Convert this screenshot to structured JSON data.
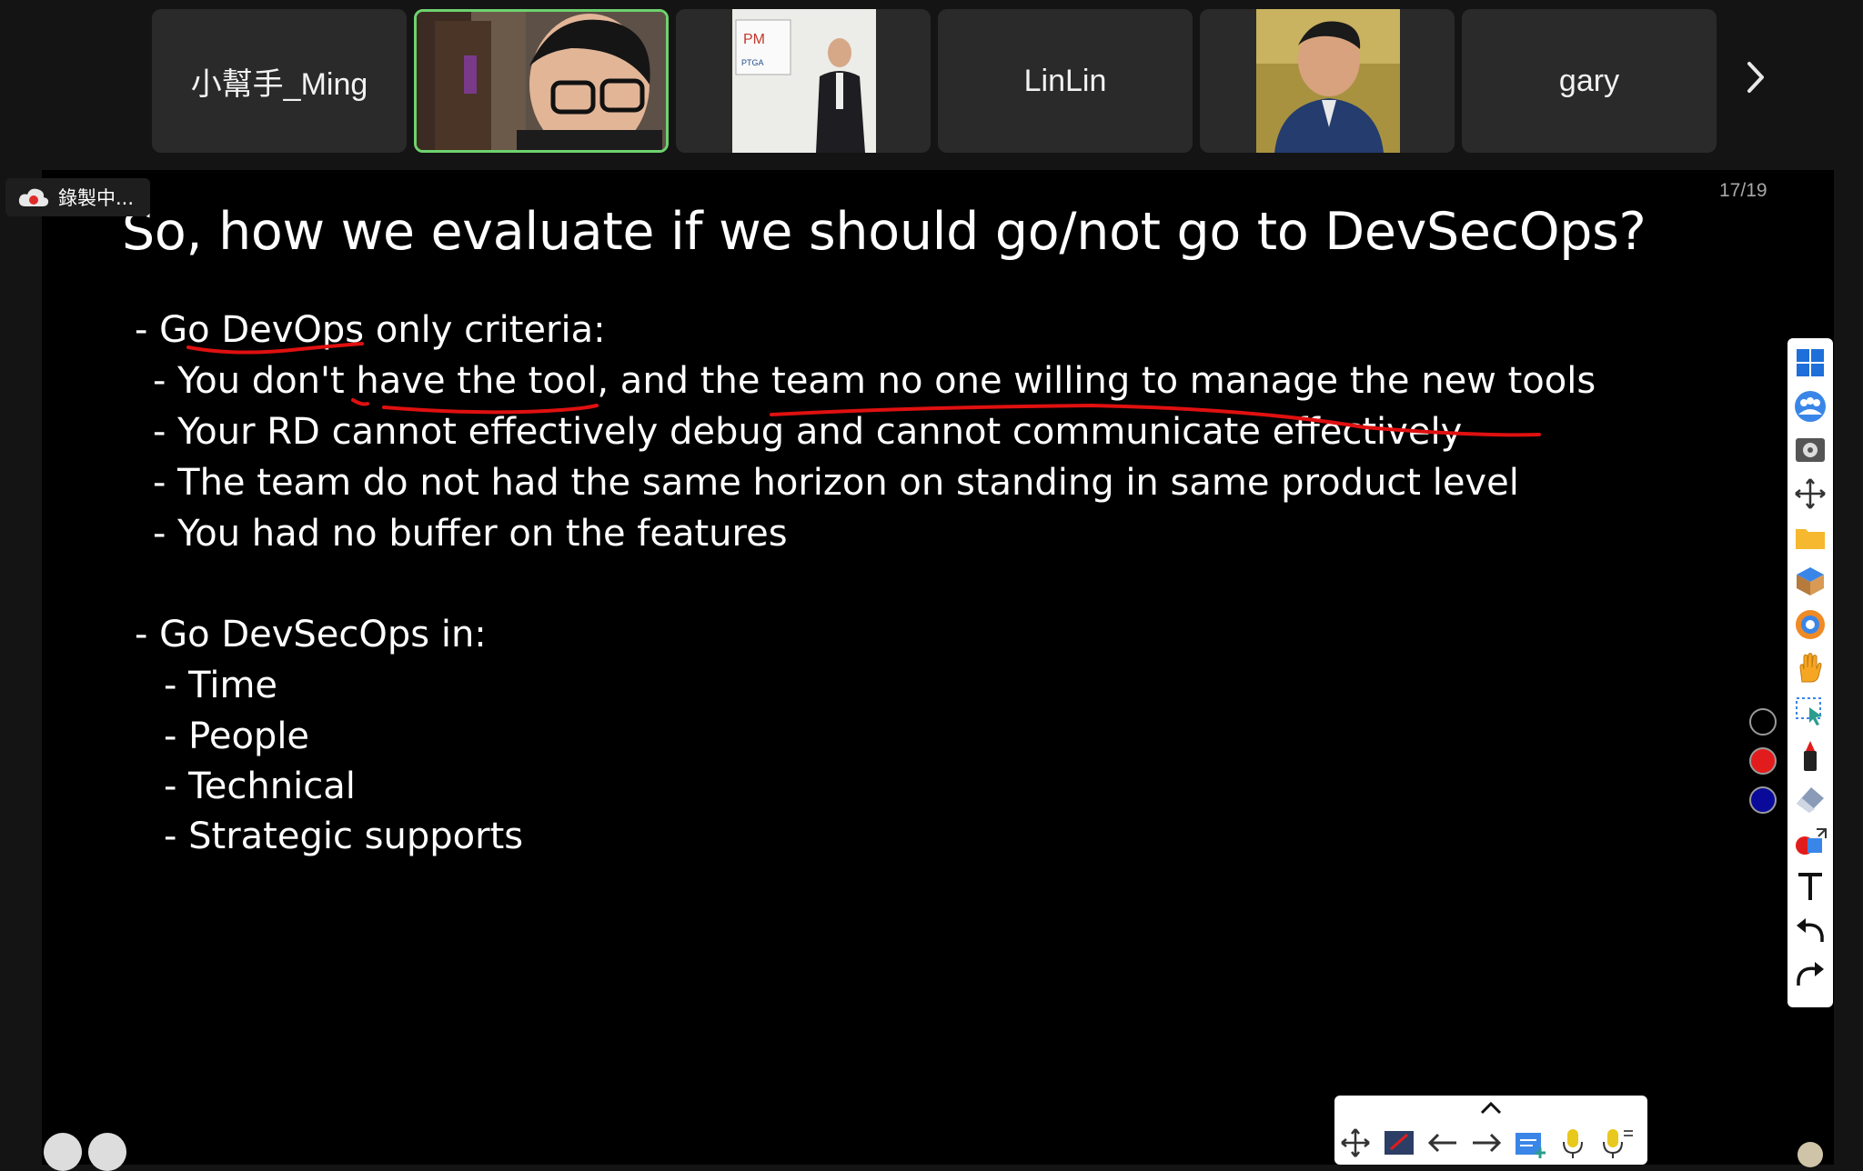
{
  "participants": [
    {
      "name": "小幫手_Ming",
      "type": "name"
    },
    {
      "name": "",
      "type": "video",
      "active": true
    },
    {
      "name": "",
      "type": "photo"
    },
    {
      "name": "LinLin",
      "type": "name"
    },
    {
      "name": "",
      "type": "photo"
    },
    {
      "name": "gary",
      "type": "name"
    }
  ],
  "recording": {
    "label": "錄製中..."
  },
  "slide": {
    "page": "17/19",
    "title": "So, how we evaluate if we should go/not go to DevSecOps?",
    "lines": [
      "- Go DevOps only criteria:",
      "- You don't have the tool, and the team no one willing to manage the new tools",
      "- Your RD cannot effectively debug and cannot communicate effectively",
      "- The team do not had the same horizon on standing in same product level",
      "- You had no buffer on the features",
      "- Go DevSecOps in:",
      "- Time",
      "- People",
      "- Technical",
      "- Strategic  supports"
    ]
  },
  "colors": {
    "annotation": "#e01010",
    "active_border": "#6ed36e",
    "pen_red": "#e21c1c",
    "pen_blue": "#0a0a9a"
  },
  "right_toolbar": [
    "grid-icon",
    "people-icon",
    "settings-icon",
    "move-icon",
    "folder-icon",
    "box-icon",
    "browser-icon",
    "hand-icon",
    "select-icon",
    "marker-icon",
    "eraser-icon",
    "shapes-icon",
    "text-icon",
    "undo-icon",
    "redo-icon"
  ],
  "bottom_toolbar": [
    "expand-icon",
    "move-icon",
    "whiteboard-icon",
    "prev-arrow-icon",
    "next-arrow-icon",
    "add-page-icon",
    "mic-icon",
    "mic-settings-icon"
  ]
}
